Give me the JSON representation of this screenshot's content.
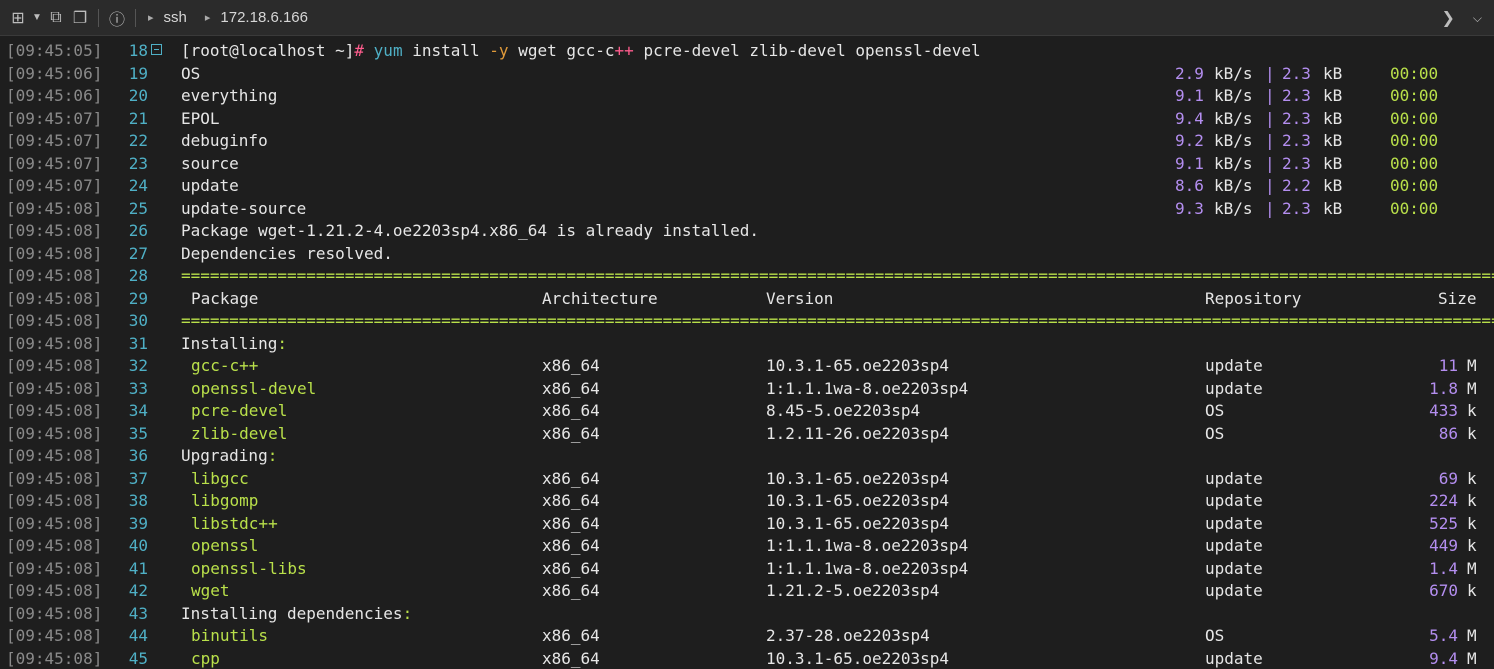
{
  "toolbar": {
    "crumbs": [
      "ssh",
      "172.18.6.166"
    ]
  },
  "command": {
    "prompt": "[root@localhost ~]",
    "hash": "#",
    "yum": "yum",
    "install": "install",
    "flag": "-y",
    "args_a": "wget gcc-c",
    "plus": "++",
    "args_b": "pcre-devel zlib-devel openssl-devel"
  },
  "repos": [
    {
      "name": "OS",
      "rate": "2.9",
      "size": "2.3",
      "time": "00:00"
    },
    {
      "name": "everything",
      "rate": "9.1",
      "size": "2.3",
      "time": "00:00"
    },
    {
      "name": "EPOL",
      "rate": "9.4",
      "size": "2.3",
      "time": "00:00"
    },
    {
      "name": "debuginfo",
      "rate": "9.2",
      "size": "2.3",
      "time": "00:00"
    },
    {
      "name": "source",
      "rate": "9.1",
      "size": "2.3",
      "time": "00:00"
    },
    {
      "name": "update",
      "rate": "8.6",
      "size": "2.2",
      "time": "00:00"
    },
    {
      "name": "update-source",
      "rate": "9.3",
      "size": "2.3",
      "time": "00:00"
    }
  ],
  "units": {
    "rate": "kB/s",
    "pipe": "|",
    "size": "kB"
  },
  "messages": {
    "already_installed": "Package wget-1.21.2-4.oe2203sp4.x86_64 is already installed.",
    "deps_resolved": "Dependencies resolved."
  },
  "separator": "==================================================================================================================================================================",
  "table_headers": {
    "package": "Package",
    "arch": "Architecture",
    "version": "Version",
    "repo": "Repository",
    "size": "Size"
  },
  "sections": [
    {
      "title": "Installing",
      "rows": [
        {
          "pkg": "gcc-c++",
          "arch": "x86_64",
          "ver": "10.3.1-65.oe2203sp4",
          "repo": "update",
          "size": "11",
          "unit": "M"
        },
        {
          "pkg": "openssl-devel",
          "arch": "x86_64",
          "ver": "1:1.1.1wa-8.oe2203sp4",
          "repo": "update",
          "size": "1.8",
          "unit": "M"
        },
        {
          "pkg": "pcre-devel",
          "arch": "x86_64",
          "ver": "8.45-5.oe2203sp4",
          "repo": "OS",
          "size": "433",
          "unit": "k"
        },
        {
          "pkg": "zlib-devel",
          "arch": "x86_64",
          "ver": "1.2.11-26.oe2203sp4",
          "repo": "OS",
          "size": "86",
          "unit": "k"
        }
      ]
    },
    {
      "title": "Upgrading",
      "rows": [
        {
          "pkg": "libgcc",
          "arch": "x86_64",
          "ver": "10.3.1-65.oe2203sp4",
          "repo": "update",
          "size": "69",
          "unit": "k"
        },
        {
          "pkg": "libgomp",
          "arch": "x86_64",
          "ver": "10.3.1-65.oe2203sp4",
          "repo": "update",
          "size": "224",
          "unit": "k"
        },
        {
          "pkg": "libstdc++",
          "arch": "x86_64",
          "ver": "10.3.1-65.oe2203sp4",
          "repo": "update",
          "size": "525",
          "unit": "k"
        },
        {
          "pkg": "openssl",
          "arch": "x86_64",
          "ver": "1:1.1.1wa-8.oe2203sp4",
          "repo": "update",
          "size": "449",
          "unit": "k"
        },
        {
          "pkg": "openssl-libs",
          "arch": "x86_64",
          "ver": "1:1.1.1wa-8.oe2203sp4",
          "repo": "update",
          "size": "1.4",
          "unit": "M"
        },
        {
          "pkg": "wget",
          "arch": "x86_64",
          "ver": "1.21.2-5.oe2203sp4",
          "repo": "update",
          "size": "670",
          "unit": "k"
        }
      ]
    },
    {
      "title": "Installing dependencies",
      "rows": [
        {
          "pkg": "binutils",
          "arch": "x86_64",
          "ver": "2.37-28.oe2203sp4",
          "repo": "OS",
          "size": "5.4",
          "unit": "M"
        },
        {
          "pkg": "cpp",
          "arch": "x86_64",
          "ver": "10.3.1-65.oe2203sp4",
          "repo": "update",
          "size": "9.4",
          "unit": "M"
        }
      ]
    }
  ],
  "timestamps": [
    "[09:45:05]",
    "[09:45:06]",
    "[09:45:06]",
    "[09:45:07]",
    "[09:45:07]",
    "[09:45:07]",
    "[09:45:07]",
    "[09:45:08]",
    "[09:45:08]",
    "[09:45:08]",
    "[09:45:08]",
    "[09:45:08]",
    "[09:45:08]",
    "[09:45:08]",
    "[09:45:08]",
    "[09:45:08]",
    "[09:45:08]",
    "[09:45:08]",
    "[09:45:08]",
    "[09:45:08]",
    "[09:45:08]",
    "[09:45:08]",
    "[09:45:08]",
    "[09:45:08]",
    "[09:45:08]",
    "[09:45:08]",
    "[09:45:08]",
    "[09:45:08]"
  ],
  "line_numbers": [
    "18",
    "19",
    "20",
    "21",
    "22",
    "23",
    "24",
    "25",
    "26",
    "27",
    "28",
    "29",
    "30",
    "31",
    "32",
    "33",
    "34",
    "35",
    "36",
    "37",
    "38",
    "39",
    "40",
    "41",
    "42",
    "43",
    "44",
    "45"
  ]
}
